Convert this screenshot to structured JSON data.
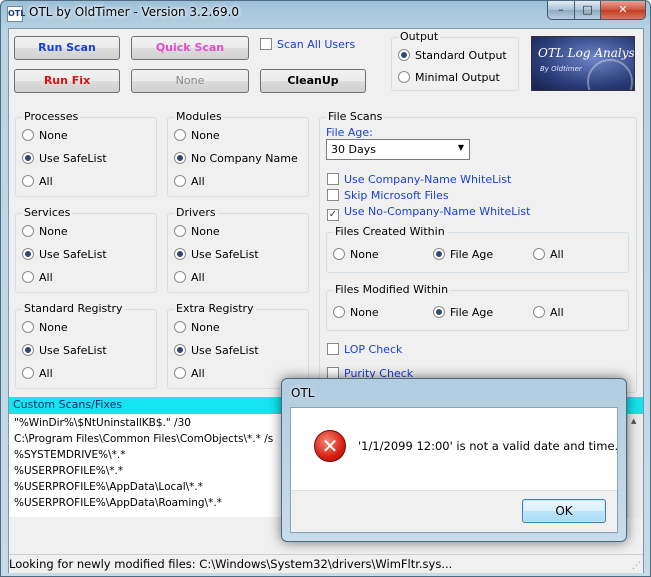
{
  "window": {
    "title": "OTL by OldTimer - Version 3.2.69.0",
    "app_icon": "OTL",
    "controls": {
      "minimize": "–",
      "maximize": "□",
      "close": "✕"
    }
  },
  "toolbar": {
    "run_scan": "Run Scan",
    "quick_scan": "Quick Scan",
    "scan_all_users": "Scan All Users",
    "run_fix": "Run Fix",
    "none": "None",
    "cleanup": "CleanUp"
  },
  "output": {
    "label": "Output",
    "standard": "Standard Output",
    "minimal": "Minimal Output"
  },
  "logo": {
    "title": "OTL Log Analysis",
    "subtitle": "By Oldtimer"
  },
  "groups": {
    "processes": {
      "label": "Processes",
      "options": [
        "None",
        "Use SafeList",
        "All"
      ],
      "selected": 1
    },
    "modules": {
      "label": "Modules",
      "options": [
        "None",
        "No Company Name",
        "All"
      ],
      "selected": 1
    },
    "services": {
      "label": "Services",
      "options": [
        "None",
        "Use SafeList",
        "All"
      ],
      "selected": 1
    },
    "drivers": {
      "label": "Drivers",
      "options": [
        "None",
        "Use SafeList",
        "All"
      ],
      "selected": 1
    },
    "standard_registry": {
      "label": "Standard Registry",
      "options": [
        "None",
        "Use SafeList",
        "All"
      ],
      "selected": 1
    },
    "extra_registry": {
      "label": "Extra Registry",
      "options": [
        "None",
        "Use SafeList",
        "All"
      ],
      "selected": 1
    }
  },
  "file_scans": {
    "label": "File Scans",
    "file_age_label": "File Age:",
    "file_age_value": "30 Days",
    "use_company_name_whitelist": "Use Company-Name WhiteList",
    "skip_microsoft_files": "Skip Microsoft Files",
    "use_no_company_name_whitelist": "Use No-Company-Name WhiteList",
    "created_within": {
      "label": "Files Created Within",
      "options": [
        "None",
        "File Age",
        "All"
      ],
      "selected": 1
    },
    "modified_within": {
      "label": "Files Modified Within",
      "options": [
        "None",
        "File Age",
        "All"
      ],
      "selected": 1
    },
    "lop_check": "LOP Check",
    "purity_check": "Purity Check"
  },
  "custom_scans": {
    "label": "Custom Scans/Fixes",
    "lines": [
      "\"%WinDir%\\$NtUninstallKB$.\" /30",
      "C:\\Program Files\\Common Files\\ComObjects\\*.* /s",
      "%SYSTEMDRIVE%\\*.*",
      "%USERPROFILE%\\*.*",
      "%USERPROFILE%\\AppData\\Local\\*.*",
      "%USERPROFILE%\\AppData\\Roaming\\*.*"
    ]
  },
  "status": "Looking for newly modified files: C:\\Windows\\System32\\drivers\\WimFltr.sys...",
  "dialog": {
    "title": "OTL",
    "message": "'1/1/2099 12:00' is not a valid date and time.",
    "ok": "OK",
    "icon": "error-icon"
  }
}
